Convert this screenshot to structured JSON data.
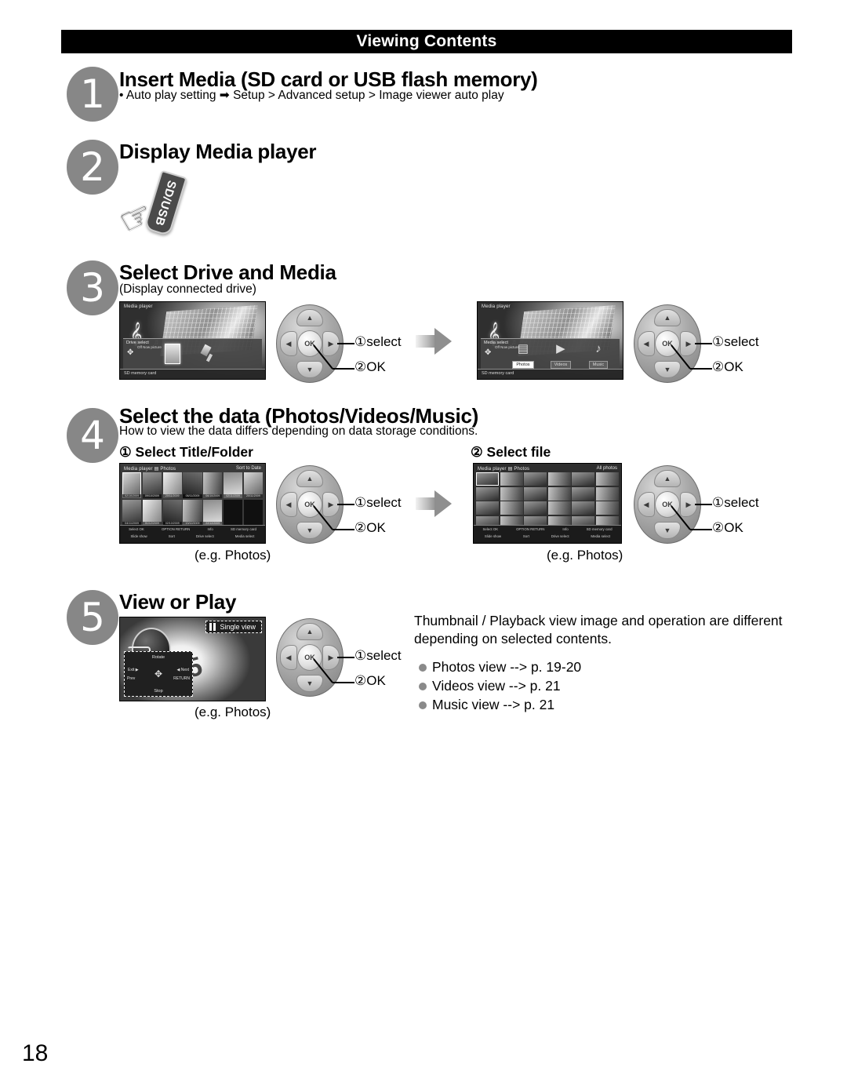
{
  "page": {
    "header_title": "Viewing Contents",
    "page_number": "18"
  },
  "steps": [
    {
      "number": "1",
      "title": "Insert Media (SD card or USB flash memory)",
      "bullet": "•  Auto play setting ➡ Setup > Advanced setup > Image viewer auto play"
    },
    {
      "number": "2",
      "title": "Display Media player",
      "icon_label": "SD/USB",
      "icon_name": "hand-press-sd-usb-icon"
    },
    {
      "number": "3",
      "title": "Select Drive and Media",
      "subtitle": "(Display connected drive)"
    },
    {
      "number": "4",
      "title": "Select the data (Photos/Videos/Music)",
      "subtitle": "How to view the data differs depending on data storage conditions.",
      "sub_head_1": "① Select Title/Folder",
      "sub_head_2": "② Select file",
      "caption_left": "(e.g. Photos)",
      "caption_right": "(e.g. Photos)"
    },
    {
      "number": "5",
      "title": "View or Play",
      "caption": "(e.g. Photos)",
      "paragraph": "Thumbnail / Playback view image and operation are different\ndepending on selected contents.",
      "bullets": [
        "Photos view --> p. 19-20",
        "Videos view --> p. 21",
        "Music view --> p. 21"
      ]
    }
  ],
  "dpad": {
    "ok_label": "OK",
    "up_glyph": "▲",
    "down_glyph": "▼",
    "left_glyph": "◀",
    "right_glyph": "▶",
    "callout_select": "①select",
    "callout_ok": "②OK"
  },
  "tv_screens": {
    "drive_select": {
      "title": "Media player",
      "panel_label": "Drive select",
      "bottom_label": "SD memory card",
      "option_lines": "Off\nNow\npicture"
    },
    "media_select": {
      "title": "Media player",
      "panel_label": "Media select",
      "bottom_label": "SD memory card",
      "option_lines": "Off\nNow\npicture",
      "items": [
        {
          "glyph": "▤",
          "label": "Photos",
          "selected": true
        },
        {
          "glyph": "▶",
          "label": "Videos",
          "selected": false
        },
        {
          "glyph": "♪",
          "label": "Music",
          "selected": false
        }
      ]
    },
    "title_folder": {
      "title": "Media player  ▤  Photos",
      "title_right": "Sort to Date",
      "dates": [
        "02/10/2009",
        "09/10/2009",
        "20/11/2009",
        "06/11/2009",
        "06/10/2009",
        "02/11/2009",
        "20/11/2009",
        "04/11/2009",
        "01/12/2009",
        "02/10/2009",
        "13/12/2009",
        "22/12/2009"
      ],
      "guide_top": [
        "Select     OK",
        "OPTION     RETURN",
        "Info",
        "SD memory card"
      ],
      "guide_bottom": [
        "Slide show",
        "Sort",
        "Drive select",
        "Media select"
      ]
    },
    "file_select": {
      "title": "Media player  ▤  Photos",
      "title_right": "All photos",
      "guide_top": [
        "Select     OK",
        "OPTION     RETURN",
        "Info",
        "SD memory card"
      ],
      "guide_bottom": [
        "Slide show",
        "Sort",
        "Drive select",
        "Media select"
      ]
    },
    "playback": {
      "badge": "Single view",
      "osd": {
        "rotate": "Rotate",
        "stop": "Stop",
        "exit": "Exit ▶",
        "next": "◀ Next",
        "prev": "Prev",
        "return": "RETURN"
      }
    }
  },
  "icons": {
    "flow_arrow": "flow-arrow-right-icon"
  }
}
